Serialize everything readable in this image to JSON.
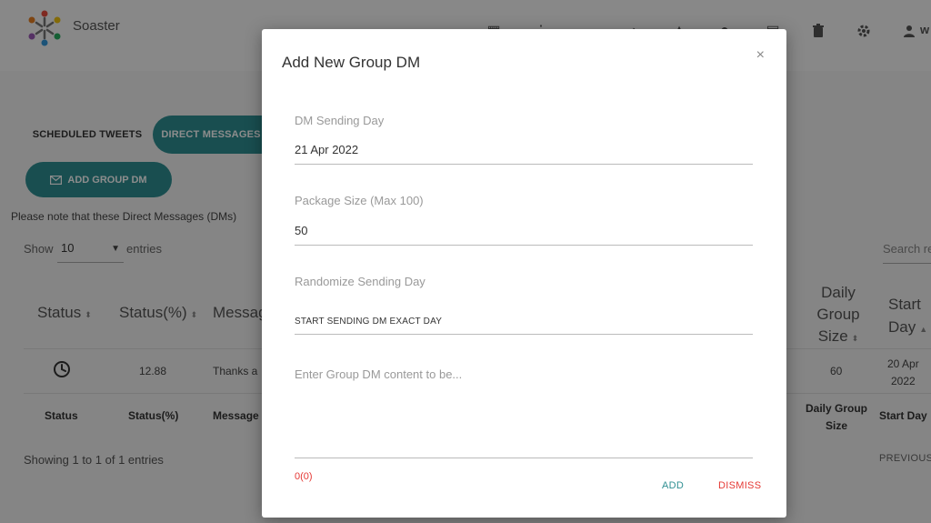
{
  "app": {
    "brand": "Soaster",
    "user_initial": "w"
  },
  "tabs": {
    "scheduled": "SCHEDULED TWEETS",
    "direct": "DIRECT MESSAGES"
  },
  "add_group_button": "ADD GROUP DM",
  "note": "Please note that these Direct Messages (DMs)",
  "length": {
    "show_label": "Show",
    "value": "10",
    "entries_label": "entries"
  },
  "search": {
    "placeholder": "Search re"
  },
  "table": {
    "headers": {
      "status": "Status",
      "status_pct": "Status(%)",
      "message": "Messag",
      "daily_l1": "Daily",
      "daily_l2": "Group",
      "daily_l3": "Size",
      "start_l1": "Start",
      "start_l2": "Day"
    },
    "row": {
      "status_pct": "12.88",
      "message": "Thanks a",
      "daily_size": "60",
      "start_l1": "20 Apr",
      "start_l2": "2022"
    },
    "footer": {
      "status": "Status",
      "status_pct": "Status(%)",
      "message": "Message",
      "daily_l1": "Daily Group",
      "daily_l2": "Size",
      "start": "Start Day"
    }
  },
  "info": "Showing 1 to 1 of 1 entries",
  "pagination": {
    "previous": "PREVIOUS"
  },
  "modal": {
    "title": "Add New Group DM",
    "close": "×",
    "sending_day_label": "DM Sending Day",
    "sending_day_value": "21 Apr 2022",
    "package_label": "Package Size (Max 100)",
    "package_value": "50",
    "randomize_label": "Randomize Sending Day",
    "randomize_value": "START SENDING DM EXACT DAY",
    "content_placeholder": "Enter Group DM content to be...",
    "counter": "0(0)",
    "add": "ADD",
    "dismiss": "DISMISS"
  },
  "colors": {
    "accent": "#2f8f92",
    "danger": "#e53935"
  }
}
